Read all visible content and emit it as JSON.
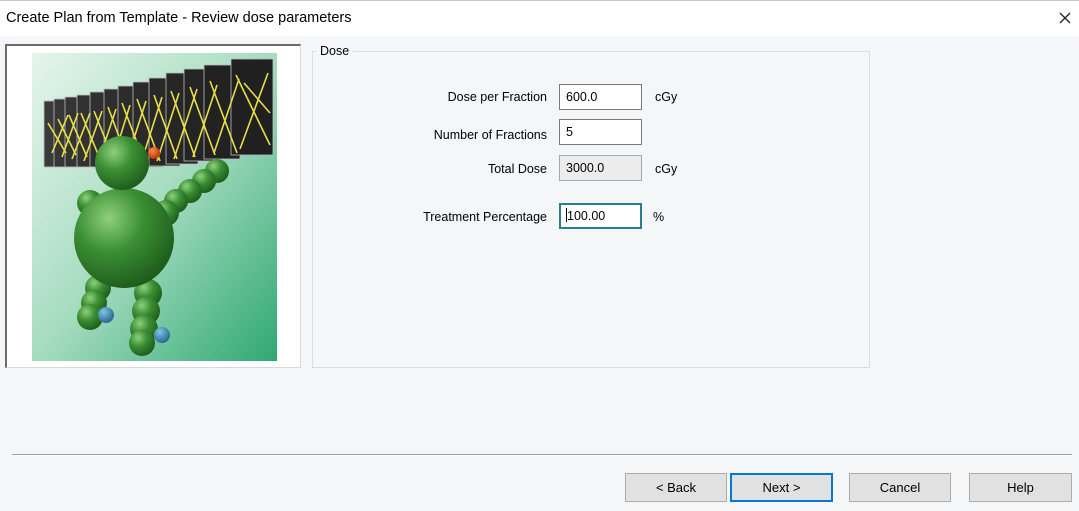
{
  "window": {
    "title": "Create Plan from Template - Review dose parameters",
    "close_icon": "close-icon"
  },
  "illustration": {
    "icon": "robot-beam-illustration",
    "colors": {
      "body": "#3d8f3a",
      "background_top": "#d8efe2",
      "background_bottom": "#3aaa78",
      "beam_lines": "#f2e94a"
    }
  },
  "dose_group": {
    "legend": "Dose",
    "dose_per_fraction": {
      "label": "Dose per Fraction",
      "value": "600.0",
      "unit": "cGy"
    },
    "number_of_fractions": {
      "label": "Number of Fractions",
      "value": "5"
    },
    "total_dose": {
      "label": "Total Dose",
      "value": "3000.0",
      "unit": "cGy"
    },
    "treatment_percentage": {
      "label": "Treatment Percentage",
      "value": "100.00",
      "unit": "%"
    }
  },
  "buttons": {
    "back": "< Back",
    "next": "Next >",
    "cancel": "Cancel",
    "help": "Help"
  },
  "colors": {
    "default_button_border": "#0078d7",
    "focused_field_border": "#2a7c8e"
  }
}
